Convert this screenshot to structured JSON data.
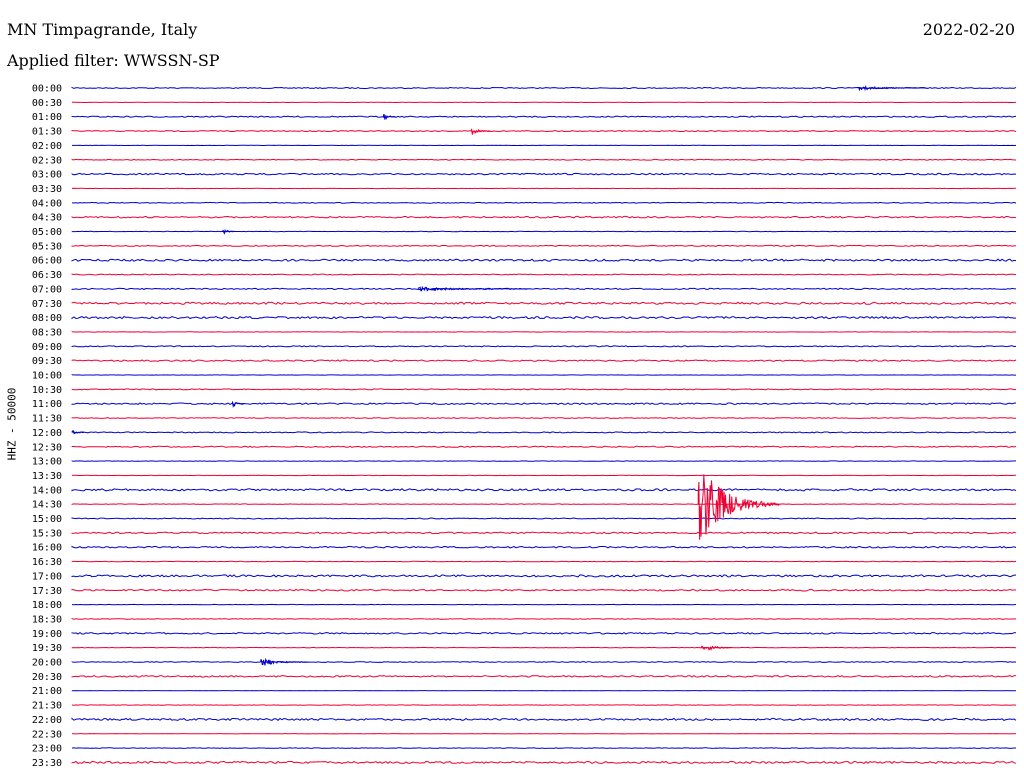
{
  "header": {
    "station": "MN Timpagrande, Italy",
    "filter": "Applied filter: WWSSN-SP",
    "date": "2022-02-20"
  },
  "chart_data": {
    "type": "line",
    "title": "MN Timpagrande, Italy",
    "subtitle": "Applied filter: WWSSN-SP",
    "date": "2022-02-20",
    "ylabel": "HHZ - 50000",
    "trace_colors": [
      "#0000cc",
      "#ee0033"
    ],
    "rows": [
      "00:00",
      "00:30",
      "01:00",
      "01:30",
      "02:00",
      "02:30",
      "03:00",
      "03:30",
      "04:00",
      "04:30",
      "05:00",
      "05:30",
      "06:00",
      "06:30",
      "07:00",
      "07:30",
      "08:00",
      "08:30",
      "09:00",
      "09:30",
      "10:00",
      "10:30",
      "11:00",
      "11:30",
      "12:00",
      "12:30",
      "13:00",
      "13:30",
      "14:00",
      "14:30",
      "15:00",
      "15:30",
      "16:00",
      "16:30",
      "17:00",
      "17:30",
      "18:00",
      "18:30",
      "19:00",
      "19:30",
      "20:00",
      "20:30",
      "21:00",
      "21:30",
      "22:00",
      "22:30",
      "23:00",
      "23:30"
    ],
    "noise_level": [
      1,
      0.3,
      1.2,
      1,
      0.2,
      0.8,
      1.5,
      0.3,
      0.8,
      1.5,
      0.4,
      1,
      2,
      1,
      1.2,
      2,
      2,
      0.3,
      1,
      1.4,
      0.3,
      1,
      1.5,
      0.8,
      1,
      1.2,
      0.5,
      0.4,
      2,
      0.5,
      1,
      1.5,
      1.5,
      0.6,
      2,
      1.5,
      0.4,
      0.6,
      1.5,
      0.5,
      0.8,
      1.5,
      0.3,
      0.4,
      2,
      0.3,
      0.6,
      2
    ],
    "events": [
      {
        "row": 0,
        "start_min": 25.0,
        "duration_min": 2.2,
        "amp": 2
      },
      {
        "row": 2,
        "start_min": 9.9,
        "duration_min": 0.4,
        "amp": 4
      },
      {
        "row": 3,
        "start_min": 12.7,
        "duration_min": 0.6,
        "amp": 4
      },
      {
        "row": 10,
        "start_min": 4.8,
        "duration_min": 0.4,
        "amp": 3
      },
      {
        "row": 14,
        "start_min": 11.0,
        "duration_min": 3.5,
        "amp": 2
      },
      {
        "row": 22,
        "start_min": 5.1,
        "duration_min": 0.4,
        "amp": 3
      },
      {
        "row": 24,
        "start_min": 0.0,
        "duration_min": 0.4,
        "amp": 2
      },
      {
        "row": 29,
        "start_min": 19.9,
        "duration_min": 2.6,
        "amp": 36
      },
      {
        "row": 39,
        "start_min": 20.0,
        "duration_min": 1.0,
        "amp": 5
      },
      {
        "row": 40,
        "start_min": 6.0,
        "duration_min": 1.5,
        "amp": 4
      }
    ]
  }
}
